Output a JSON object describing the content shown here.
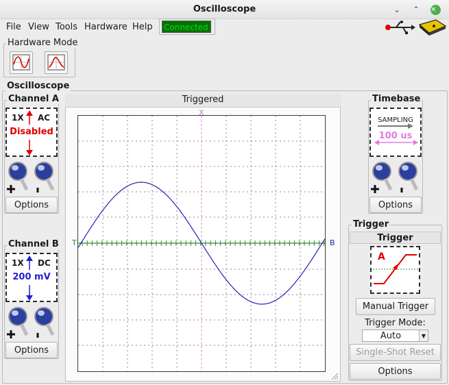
{
  "window": {
    "title": "Oscilloscope",
    "minimize": "⌄",
    "maximize": "⌃",
    "close": "✕"
  },
  "menu": [
    "File",
    "View",
    "Tools",
    "Hardware",
    "Help"
  ],
  "connection_status": "Connected",
  "hardware_mode": {
    "label": "Hardware Mode"
  },
  "oscilloscope_label": "Oscilloscope",
  "channel_a": {
    "title": "Channel A",
    "probe": "1X",
    "coupling": "AC",
    "range": "Disabled",
    "options": "Options"
  },
  "channel_b": {
    "title": "Channel B",
    "probe": "1X",
    "coupling": "DC",
    "range": "200 mV",
    "options": "Options"
  },
  "plot": {
    "header": "Triggered",
    "x_marker": "X",
    "trigger_marker": "T",
    "b_marker": "B"
  },
  "timebase": {
    "title": "Timebase",
    "mode": "SAMPLING",
    "value": "100 us",
    "options": "Options"
  },
  "trigger": {
    "group": "Trigger",
    "title": "Trigger",
    "source": "A",
    "manual_button": "Manual Trigger",
    "mode_label": "Trigger Mode:",
    "mode_value": "Auto",
    "single_shot": "Single-Shot Reset",
    "options": "Options"
  },
  "colors": {
    "status_bg": "#007300",
    "status_text": "#16d516",
    "channel_a": "#e00000",
    "channel_b": "#1f1fd6",
    "trace": "#2323b4",
    "trigger_line": "#2f8a2f",
    "timebase": "#e07de0"
  }
}
